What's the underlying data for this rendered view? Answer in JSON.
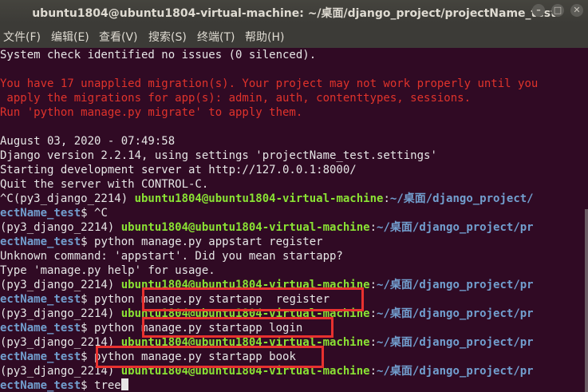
{
  "window": {
    "title": "ubuntu1804@ubuntu1804-virtual-machine: ~/桌面/django_project/projectName_test",
    "minimize": "–",
    "maximize": "□",
    "close": "✕"
  },
  "menu": [
    "文件(F)",
    "编辑(E)",
    "查看(V)",
    "搜索(S)",
    "终端(T)",
    "帮助(H)"
  ],
  "terminal": {
    "l0": "System check identified no issues (0 silenced).",
    "l2": "You have 17 unapplied migration(s). Your project may not work properly until you",
    "l3": " apply the migrations for app(s): admin, auth, contenttypes, sessions.",
    "l4": "Run 'python manage.py migrate' to apply them.",
    "l6": "August 03, 2020 - 07:49:58",
    "l7": "Django version 2.2.14, using settings 'projectName_test.settings'",
    "l8": "Starting development server at http://127.0.0.1:8000/",
    "l9": "Quit the server with CONTROL-C.",
    "env": "(py3_django_2214) ",
    "env_ctrlc": "^C(py3_django_2214) ",
    "user_host": "ubuntu1804@ubuntu1804-virtual-machine",
    "colon": ":",
    "path_head_a": "~/桌面/django_project/",
    "path_head_b": "~/桌面/django_project/pr",
    "path_tail": "ectName_test",
    "prompt_sym": "$ ",
    "cmd1": "^C",
    "cmd2": "python manage.py appstart register",
    "out1": "Unknown command: 'appstart'. Did you mean startapp?",
    "out2": "Type 'manage.py help' for usage.",
    "cmd3": "python manage.py startapp  register",
    "cmd4": "python manage.py startapp login",
    "cmd5": "python manage.py startapp book",
    "cmd6": "tree"
  },
  "colors": {
    "background": "#300a24",
    "error_text": "#e0332b",
    "user_host": "#8ae234",
    "path": "#729fcf",
    "highlight_box": "#e8312f"
  }
}
